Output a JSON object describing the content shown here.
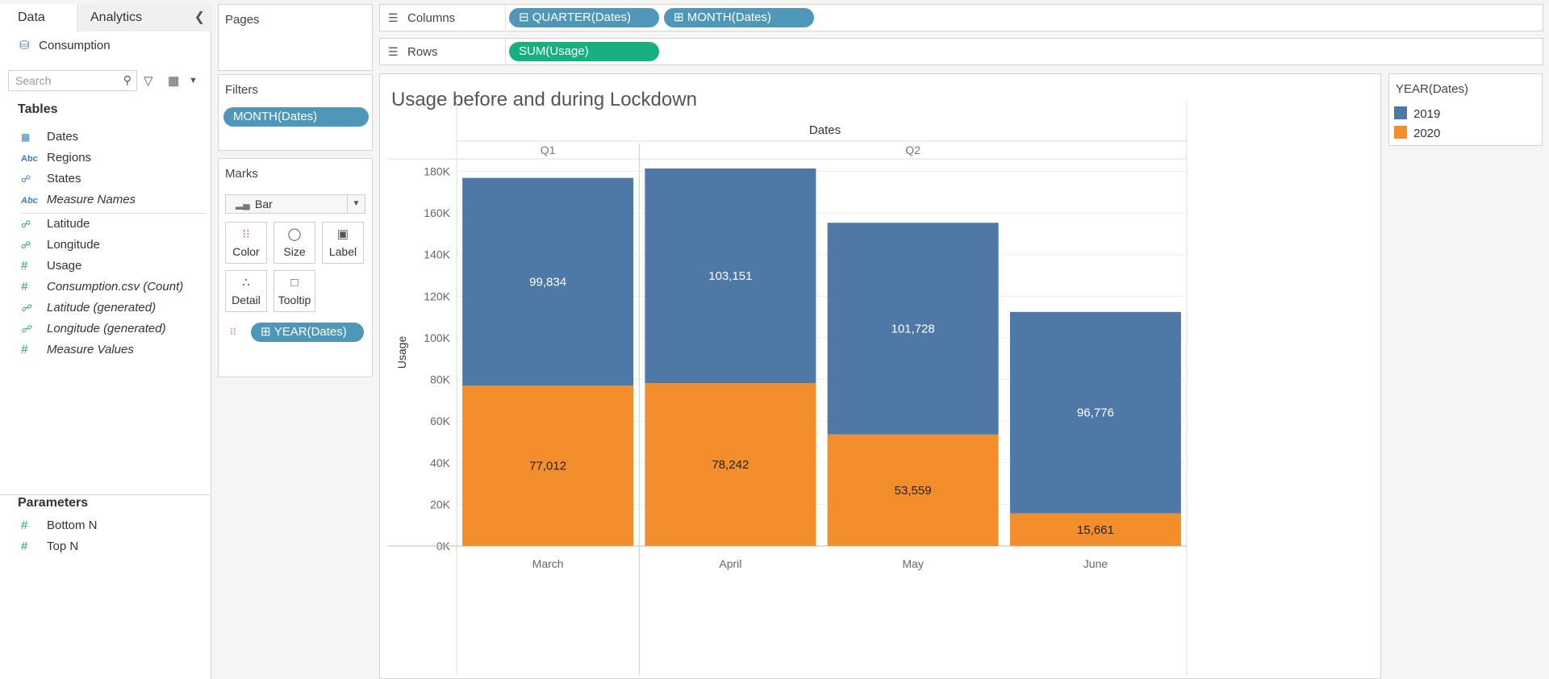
{
  "data_pane": {
    "tabs": [
      "Data",
      "Analytics"
    ],
    "datasource": "Consumption",
    "search_placeholder": "Search",
    "tables_title": "Tables",
    "fields": [
      {
        "icon": "calendar-icon",
        "name": "Dates",
        "italic": false
      },
      {
        "icon": "abc-icon",
        "name": "Regions",
        "italic": false
      },
      {
        "icon": "globe-icon",
        "name": "States",
        "italic": false
      },
      {
        "icon": "abc-icon",
        "name": "Measure Names",
        "italic": true
      },
      {
        "icon": "globe-icon",
        "name": "Latitude",
        "italic": false
      },
      {
        "icon": "globe-icon",
        "name": "Longitude",
        "italic": false
      },
      {
        "icon": "hash-icon",
        "name": "Usage",
        "italic": false
      },
      {
        "icon": "hash-icon",
        "name": "Consumption.csv (Count)",
        "italic": true
      },
      {
        "icon": "globe-icon",
        "name": "Latitude (generated)",
        "italic": true
      },
      {
        "icon": "globe-icon",
        "name": "Longitude (generated)",
        "italic": true
      },
      {
        "icon": "hash-icon",
        "name": "Measure Values",
        "italic": true
      }
    ],
    "parameters_title": "Parameters",
    "parameters": [
      "Bottom N",
      "Top N"
    ]
  },
  "pages": {
    "title": "Pages"
  },
  "filters": {
    "title": "Filters",
    "pill": "MONTH(Dates)"
  },
  "marks": {
    "title": "Marks",
    "type": "Bar",
    "buttons": [
      "Color",
      "Size",
      "Label",
      "Detail",
      "Tooltip"
    ],
    "color_pill": "YEAR(Dates)"
  },
  "columns": {
    "label": "Columns",
    "pills": [
      "QUARTER(Dates)",
      "MONTH(Dates)"
    ]
  },
  "rows": {
    "label": "Rows",
    "pills": [
      "SUM(Usage)"
    ]
  },
  "legend": {
    "title": "YEAR(Dates)",
    "items": [
      {
        "label": "2019",
        "color": "#4e79a7"
      },
      {
        "label": "2020",
        "color": "#f28e2b"
      }
    ]
  },
  "chart_data": {
    "type": "bar",
    "stacked": true,
    "title": "Usage before and during Lockdown",
    "column_header": "Dates",
    "quarters": [
      {
        "label": "Q1",
        "months": [
          "March"
        ]
      },
      {
        "label": "Q2",
        "months": [
          "April",
          "May",
          "June"
        ]
      }
    ],
    "categories": [
      "March",
      "April",
      "May",
      "June"
    ],
    "series": [
      {
        "name": "2020",
        "color": "#f28e2b",
        "values": [
          77012,
          78242,
          53559,
          15661
        ],
        "labels": [
          "77,012",
          "78,242",
          "53,559",
          "15,661"
        ]
      },
      {
        "name": "2019",
        "color": "#4e79a7",
        "values": [
          99834,
          103151,
          101728,
          96776
        ],
        "labels": [
          "99,834",
          "103,151",
          "101,728",
          "96,776"
        ]
      }
    ],
    "ylabel": "Usage",
    "ylim": [
      0,
      180000
    ],
    "yticks": [
      {
        "v": 0,
        "label": "0K"
      },
      {
        "v": 20000,
        "label": "20K"
      },
      {
        "v": 40000,
        "label": "40K"
      },
      {
        "v": 60000,
        "label": "60K"
      },
      {
        "v": 80000,
        "label": "80K"
      },
      {
        "v": 100000,
        "label": "100K"
      },
      {
        "v": 120000,
        "label": "120K"
      },
      {
        "v": 140000,
        "label": "140K"
      },
      {
        "v": 160000,
        "label": "160K"
      },
      {
        "v": 180000,
        "label": "180K"
      }
    ],
    "grid": true
  }
}
